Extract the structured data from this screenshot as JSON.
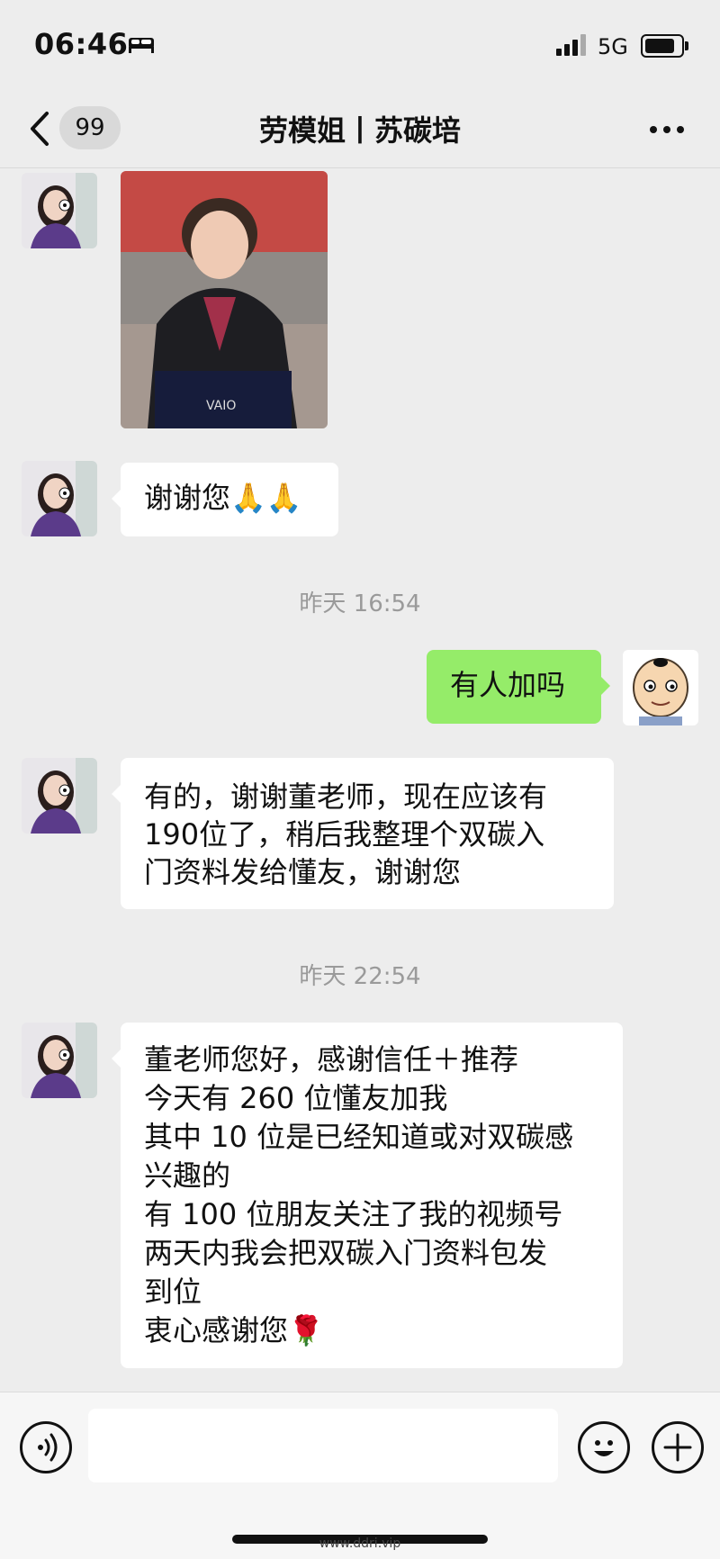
{
  "status_bar": {
    "time": "06:46",
    "network": "5G",
    "battery_level": 0.85
  },
  "nav": {
    "unread_count": "99",
    "title": "劳模姐丨苏碳培"
  },
  "messages": [
    {
      "type": "image",
      "direction": "incoming"
    },
    {
      "type": "text",
      "direction": "incoming",
      "lines": [
        "谢谢您🙏🙏"
      ]
    },
    {
      "type": "timestamp",
      "text": "昨天 16:54"
    },
    {
      "type": "text",
      "direction": "outgoing",
      "lines": [
        "有人加吗"
      ]
    },
    {
      "type": "text",
      "direction": "incoming",
      "lines": [
        "有的，谢谢董老师，现在应该有",
        "190位了，稍后我整理个双碳入",
        "门资料发给懂友，谢谢您"
      ]
    },
    {
      "type": "timestamp",
      "text": "昨天 22:54"
    },
    {
      "type": "text",
      "direction": "incoming",
      "lines": [
        "董老师您好，感谢信任＋推荐",
        "今天有 260 位懂友加我",
        "其中 10 位是已经知道或对双碳感",
        "兴趣的",
        "有 100 位朋友关注了我的视频号",
        "两天内我会把双碳入门资料包发",
        "到位",
        "衷心感谢您🌹"
      ]
    }
  ],
  "watermark": "www.ddri.vip",
  "colors": {
    "background": "#ededed",
    "outgoing_bubble": "#95ec69",
    "incoming_bubble": "#ffffff"
  },
  "icons": [
    "back-icon",
    "more-icon",
    "voice-icon",
    "emoji-icon",
    "plus-icon",
    "signal-icon",
    "battery-icon",
    "sleep-mode-icon"
  ]
}
